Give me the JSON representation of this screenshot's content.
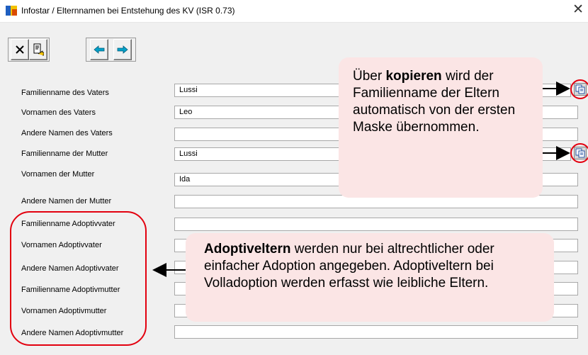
{
  "window": {
    "title": "Infostar /  Elternnamen bei Entstehung des KV (ISR 0.73)",
    "close_glyph": "✕"
  },
  "toolbar": {
    "buttons": [
      {
        "name": "close-form-button",
        "icon": "x-icon",
        "glyph": "✕"
      },
      {
        "name": "insert-record-button",
        "icon": "document-arrow-icon",
        "glyph": "⎗"
      },
      {
        "name": "previous-button",
        "icon": "arrow-left-icon",
        "glyph": "⇦"
      },
      {
        "name": "next-button",
        "icon": "arrow-right-icon",
        "glyph": "⇨"
      }
    ]
  },
  "fields": [
    {
      "label": "Familienname des Vaters",
      "value": "Lussi"
    },
    {
      "label": "Vornamen des Vaters",
      "value": "Leo"
    },
    {
      "label": "Andere Namen des Vaters",
      "value": ""
    },
    {
      "label": "Familienname der Mutter",
      "value": "Lussi"
    },
    {
      "label": "Vornamen der Mutter",
      "value": "Ida"
    },
    {
      "label": "Andere Namen der Mutter",
      "value": ""
    },
    {
      "label": "Familienname Adoptivvater",
      "value": ""
    },
    {
      "label": "Vornamen Adoptivvater",
      "value": ""
    },
    {
      "label": "Andere Namen Adoptivvater",
      "value": ""
    },
    {
      "label": "Familienname Adoptivmutter",
      "value": ""
    },
    {
      "label": "Vornamen Adoptivmutter",
      "value": ""
    },
    {
      "label": "Andere Namen Adoptivmutter",
      "value": ""
    }
  ],
  "callouts": {
    "copy_pre": "Über ",
    "copy_bold": "kopieren",
    "copy_post": " wird der Familienname der Eltern automatisch von der ersten Maske übernommen.",
    "adopt_bold": "Adoptiveltern",
    "adopt_post": " werden nur bei altrechtlicher oder einfacher Adoption angegeben. Adop­tiveltern bei Volladoption werden erfasst wie leibliche Eltern."
  },
  "colors": {
    "annotation_red": "#e3000f",
    "callout_bg": "#fbe5e5",
    "arrow_cyan": "#00a0c8"
  }
}
